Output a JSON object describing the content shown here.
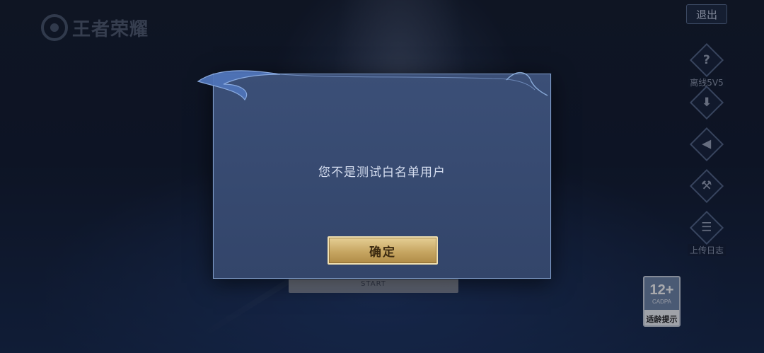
{
  "game": {
    "logo_text": "王者荣耀"
  },
  "header": {
    "exit_label": "退出"
  },
  "sidebar": {
    "items": [
      {
        "icon": "question-icon",
        "glyph": "?",
        "label": "离线5V5"
      },
      {
        "icon": "download-icon",
        "glyph": "⬇",
        "label": ""
      },
      {
        "icon": "speaker-icon",
        "glyph": "🔊",
        "label": ""
      },
      {
        "icon": "repair-icon",
        "glyph": "⚒",
        "label": ""
      },
      {
        "icon": "clipboard-icon",
        "glyph": "☰",
        "label": "上传日志"
      }
    ]
  },
  "age_rating": {
    "number": "12+",
    "org": "CADPA",
    "tip": "适龄提示"
  },
  "start_button": {
    "label": "START"
  },
  "dialog": {
    "message": "您不是测试白名单用户",
    "confirm_label": "确定"
  },
  "colors": {
    "dialog_bg": "#3b4f77",
    "dialog_border": "#7f9cc8",
    "confirm_gold": "#c7a662"
  }
}
